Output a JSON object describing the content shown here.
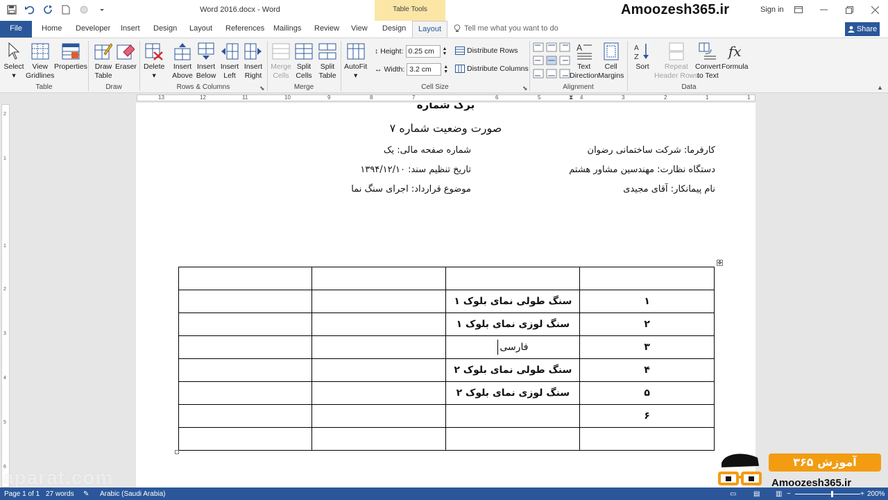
{
  "window": {
    "title": "Word 2016.docx - Word",
    "contextual_header": "Table Tools",
    "brand": "Amoozesh365.ir",
    "sign_in": "Sign in"
  },
  "tabs": {
    "file": "File",
    "items": [
      "Home",
      "Developer",
      "Insert",
      "Design",
      "Layout",
      "References",
      "Mailings",
      "Review",
      "View",
      "Design"
    ],
    "active": "Layout",
    "tell_me": "Tell me what you want to do",
    "share": "Share"
  },
  "ribbon": {
    "table": {
      "label": "Table",
      "select": "Select",
      "view_gridlines_1": "View",
      "view_gridlines_2": "Gridlines",
      "properties": "Properties"
    },
    "draw": {
      "label": "Draw",
      "draw_table_1": "Draw",
      "draw_table_2": "Table",
      "eraser": "Eraser"
    },
    "rows_columns": {
      "label": "Rows & Columns",
      "delete": "Delete",
      "insert_above_1": "Insert",
      "insert_above_2": "Above",
      "insert_below_1": "Insert",
      "insert_below_2": "Below",
      "insert_left_1": "Insert",
      "insert_left_2": "Left",
      "insert_right_1": "Insert",
      "insert_right_2": "Right"
    },
    "merge": {
      "label": "Merge",
      "merge_cells_1": "Merge",
      "merge_cells_2": "Cells",
      "split_cells_1": "Split",
      "split_cells_2": "Cells",
      "split_table_1": "Split",
      "split_table_2": "Table"
    },
    "cell_size": {
      "label": "Cell Size",
      "autofit": "AutoFit",
      "height_label": "Height:",
      "height_value": "0.25 cm",
      "width_label": "Width:",
      "width_value": "3.2 cm",
      "distribute_rows": "Distribute Rows",
      "distribute_columns": "Distribute Columns"
    },
    "alignment": {
      "label": "Alignment",
      "text_direction_1": "Text",
      "text_direction_2": "Direction",
      "cell_margins_1": "Cell",
      "cell_margins_2": "Margins"
    },
    "data": {
      "label": "Data",
      "sort": "Sort",
      "repeat_header_1": "Repeat",
      "repeat_header_2": "Header Rows",
      "convert_1": "Convert",
      "convert_2": "to Text",
      "formula": "Formula"
    }
  },
  "ruler": {
    "h_ticks": [
      "13",
      "12",
      "11",
      "10",
      "9",
      "8",
      "7",
      "6",
      "5",
      "4",
      "3",
      "2",
      "1",
      "1"
    ],
    "v_ticks": [
      "2",
      "1",
      "1",
      "2",
      "3",
      "4",
      "5",
      "6"
    ]
  },
  "document": {
    "heading_top": "برگ شماره",
    "heading": "صورت وضعیت شماره ۷",
    "info_right": [
      "کارفرما: شرکت ساختمانی رضوان",
      "دستگاه نظارت: مهندسین مشاور هشتم",
      "نام پیمانکار: آقای مجیدی"
    ],
    "info_left": [
      "شماره صفحه مالی: یک",
      "تاریخ تنظیم سند: ۱۳۹۴/۱۲/۱۰",
      "موضوع قرارداد: اجرای سنگ نما"
    ],
    "table_rows": [
      {
        "num": "",
        "desc": ""
      },
      {
        "num": "۱",
        "desc": "سنگ طولی نمای بلوک ۱"
      },
      {
        "num": "۲",
        "desc": "سنگ لوزی نمای بلوک ۱"
      },
      {
        "num": "۳",
        "desc": "فارسی"
      },
      {
        "num": "۴",
        "desc": "سنگ طولی نمای بلوک ۲"
      },
      {
        "num": "۵",
        "desc": "سنگ لوزی نمای بلوک ۲"
      },
      {
        "num": "۶",
        "desc": ""
      },
      {
        "num": "",
        "desc": ""
      }
    ]
  },
  "watermark": "aparat.com",
  "logo": {
    "text": "Amoozesh365.ir",
    "script": "آموزش ۳۶۵"
  },
  "status": {
    "page": "Page 1 of 1",
    "words": "27 words",
    "language": "Arabic (Saudi Arabia)",
    "zoom": "200%"
  },
  "colors": {
    "accent": "#2b579a",
    "contextual": "#fbe6a6",
    "logo_orange": "#f39c12"
  }
}
